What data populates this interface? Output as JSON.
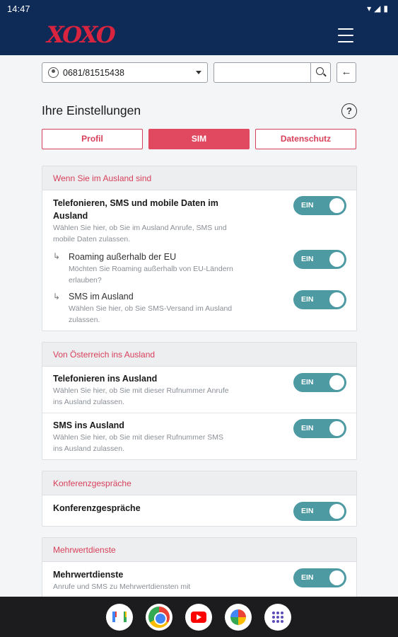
{
  "status_bar": {
    "time": "14:47",
    "system_icons": "▾◢▮"
  },
  "app": {
    "logo_text": "XOXO",
    "menu_icon": "hamburger-icon"
  },
  "toolbar": {
    "phone_number": "0681/81515438",
    "search_placeholder": "",
    "search_value": "",
    "back_arrow": "←"
  },
  "page": {
    "title": "Ihre Einstellungen",
    "help_symbol": "?"
  },
  "tabs": [
    {
      "label": "Profil",
      "active": false
    },
    {
      "label": "SIM",
      "active": true
    },
    {
      "label": "Datenschutz",
      "active": false
    }
  ],
  "sections": [
    {
      "title": "Wenn Sie im Ausland sind",
      "items": [
        {
          "title_line1": "Telefonieren, SMS und mobile Daten im",
          "title_line2": "Ausland",
          "desc_line1": "Wählen Sie hier, ob Sie im Ausland Anrufe, SMS und",
          "desc_line2": "mobile Daten zulassen.",
          "toggle": "EIN"
        },
        {
          "arrow": "↳",
          "title": "Roaming außerhalb der EU",
          "desc_line1": "Möchten Sie Roaming außerhalb von EU-Ländern",
          "desc_line2": "erlauben?",
          "toggle": "EIN"
        },
        {
          "arrow": "↳",
          "title": "SMS im Ausland",
          "desc_line1": "Wählen Sie hier, ob Sie SMS-Versand im Ausland",
          "desc_line2": "zulassen.",
          "toggle": "EIN"
        }
      ]
    },
    {
      "title": "Von Österreich ins Ausland",
      "items": [
        {
          "title": "Telefonieren ins Ausland",
          "desc_line1": "Wählen Sie hier, ob Sie mit dieser Rufnummer Anrufe",
          "desc_line2": "ins Ausland zulassen.",
          "toggle": "EIN"
        },
        {
          "title": "SMS ins Ausland",
          "desc_line1": "Wählen Sie hier, ob Sie mit dieser Rufnummer SMS",
          "desc_line2": "ins Ausland zulassen.",
          "toggle": "EIN"
        }
      ]
    },
    {
      "title": "Konferenzgespräche",
      "items": [
        {
          "title": "Konferenzgespräche",
          "toggle": "EIN"
        }
      ]
    },
    {
      "title": "Mehrwertdienste",
      "items": [
        {
          "title": "Mehrwertdienste",
          "desc_line1": "Anrufe und SMS zu Mehrwertdiensten mit",
          "toggle": "EIN"
        }
      ]
    }
  ],
  "dock": [
    "gmail-icon",
    "chrome-icon",
    "youtube-icon",
    "photos-icon",
    "app-drawer-icon"
  ],
  "colors": {
    "header": "#0e2a57",
    "accent": "#e0495f",
    "toggle_on": "#4d9aa3"
  }
}
